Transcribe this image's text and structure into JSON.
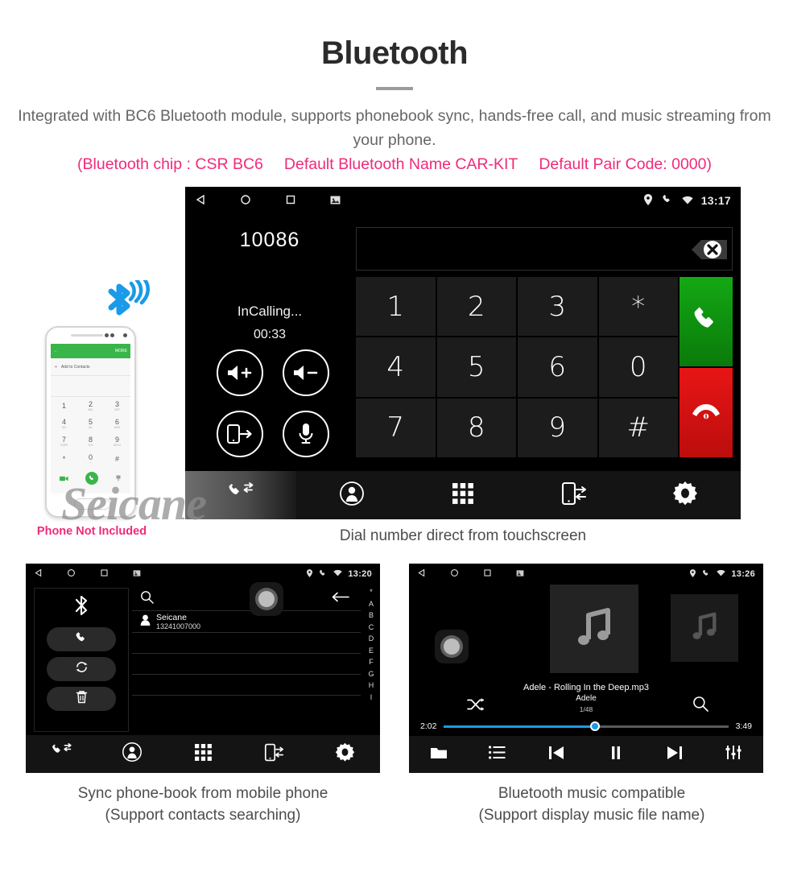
{
  "header": {
    "title": "Bluetooth",
    "description": "Integrated with BC6 Bluetooth module, supports phonebook sync, hands-free call, and music streaming from your phone.",
    "spec_chip": "(Bluetooth chip : CSR BC6",
    "spec_name": "Default Bluetooth Name CAR-KIT",
    "spec_pair": "Default Pair Code: 0000)",
    "accent_pink": "#f02a7a",
    "body_gray": "#666666"
  },
  "dialer": {
    "statusbar": {
      "back_icon": "nav-back-triangle-icon",
      "home_icon": "nav-home-circle-icon",
      "recents_icon": "nav-recents-square-icon",
      "screenshot_icon": "screenshot-icon",
      "location_icon": "location-pin-icon",
      "phone_icon": "phone-icon",
      "wifi_icon": "wifi-icon",
      "time": "13:17"
    },
    "number": "10086",
    "input_value": "",
    "backspace_icon": "backspace-delete-icon",
    "call_status": "InCalling...",
    "call_timer": "00:33",
    "controls": [
      {
        "name": "volume-up",
        "icon": "volume-up-icon"
      },
      {
        "name": "volume-down",
        "icon": "volume-down-icon"
      },
      {
        "name": "transfer-to-phone",
        "icon": "phone-transfer-icon"
      },
      {
        "name": "mute-microphone",
        "icon": "microphone-icon"
      }
    ],
    "keys": [
      "1",
      "2",
      "3",
      "*",
      "4",
      "5",
      "6",
      "0",
      "7",
      "8",
      "9",
      "#"
    ],
    "call_button": {
      "name": "answer-call",
      "icon": "phone-handset-icon",
      "color": "#14a814"
    },
    "hangup_button": {
      "name": "end-call",
      "icon": "phone-hangup-icon",
      "color": "#e81515"
    },
    "navbar": [
      {
        "name": "call-log",
        "icon": "call-log-icon",
        "active": true
      },
      {
        "name": "contacts",
        "icon": "contact-person-icon",
        "active": false
      },
      {
        "name": "dialpad",
        "icon": "dialpad-grid-icon",
        "active": false
      },
      {
        "name": "phone-sync",
        "icon": "phone-sync-icon",
        "active": false
      },
      {
        "name": "settings",
        "icon": "gear-icon",
        "active": false
      }
    ],
    "caption": "Dial number direct from touchscreen"
  },
  "phone_mock": {
    "header_back": "←",
    "header_more": "MORE",
    "add_contacts": "Add to Contacts",
    "keys": [
      {
        "d": "1",
        "s": ""
      },
      {
        "d": "2",
        "s": "ABC"
      },
      {
        "d": "3",
        "s": "DEF"
      },
      {
        "d": "4",
        "s": "GHI"
      },
      {
        "d": "5",
        "s": "JKL"
      },
      {
        "d": "6",
        "s": "MNO"
      },
      {
        "d": "7",
        "s": "PQRS"
      },
      {
        "d": "8",
        "s": "TUV"
      },
      {
        "d": "9",
        "s": "WXYZ"
      },
      {
        "d": "*",
        "s": ""
      },
      {
        "d": "0",
        "s": "+"
      },
      {
        "d": "#",
        "s": ""
      }
    ],
    "note": "Phone Not Included",
    "bluetooth_icon": "bluetooth-signal-icon",
    "watermark": "Seicane"
  },
  "phonebook": {
    "statusbar": {
      "time": "13:20"
    },
    "bluetooth_icon": "bluetooth-icon",
    "side_buttons": [
      {
        "name": "call-button",
        "icon": "phone-icon"
      },
      {
        "name": "sync-button",
        "icon": "sync-refresh-icon"
      },
      {
        "name": "delete-button",
        "icon": "trash-icon"
      }
    ],
    "search_icon": "search-icon",
    "back_icon": "arrow-left-icon",
    "search_value": "",
    "search_placeholder": "",
    "contacts": [
      {
        "name": "Seicane",
        "number": "13241007000"
      }
    ],
    "empty_rows": 3,
    "index_letters": [
      "*",
      "A",
      "B",
      "C",
      "D",
      "E",
      "F",
      "G",
      "H",
      "I"
    ],
    "navbar": [
      {
        "name": "call-log",
        "icon": "call-log-icon"
      },
      {
        "name": "contacts",
        "icon": "contact-person-icon"
      },
      {
        "name": "dialpad",
        "icon": "dialpad-grid-icon"
      },
      {
        "name": "phone-sync",
        "icon": "phone-sync-icon"
      },
      {
        "name": "settings",
        "icon": "gear-icon"
      }
    ],
    "caption_line1": "Sync phone-book from mobile phone",
    "caption_line2": "(Support contacts searching)"
  },
  "music": {
    "statusbar": {
      "time": "13:26"
    },
    "album_icon": "music-note-icon",
    "track_title": "Adele - Rolling In the Deep.mp3",
    "artist": "Adele",
    "track_count": "1/48",
    "shuffle_icon": "shuffle-icon",
    "search_icon": "search-icon",
    "elapsed": "2:02",
    "duration": "3:49",
    "progress_percent": 53,
    "progress_color": "#1e9ae6",
    "navbar": [
      {
        "name": "folder",
        "icon": "folder-icon"
      },
      {
        "name": "playlist",
        "icon": "list-icon"
      },
      {
        "name": "previous-track",
        "icon": "previous-icon"
      },
      {
        "name": "pause",
        "icon": "pause-icon"
      },
      {
        "name": "next-track",
        "icon": "next-icon"
      },
      {
        "name": "equalizer",
        "icon": "equalizer-icon"
      }
    ],
    "caption_line1": "Bluetooth music compatible",
    "caption_line2": "(Support display music file name)"
  }
}
